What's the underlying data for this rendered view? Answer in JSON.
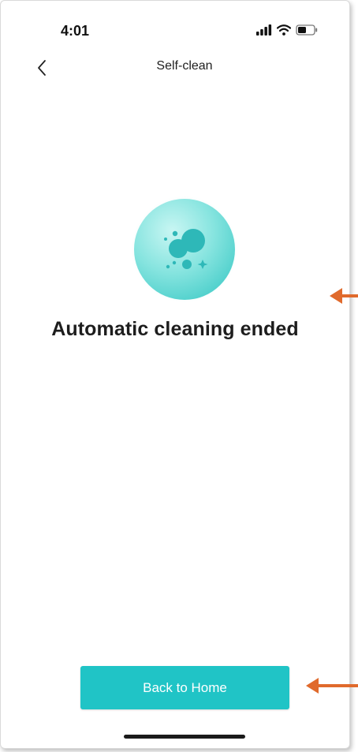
{
  "status_bar": {
    "time": "4:01",
    "icons": [
      "cellular-signal-icon",
      "wifi-icon",
      "battery-icon"
    ]
  },
  "nav": {
    "title": "Self-clean",
    "back_icon": "chevron-left-icon"
  },
  "main": {
    "illustration": "bubbles-icon",
    "message": "Automatic cleaning ended"
  },
  "footer": {
    "button_label": "Back to Home"
  },
  "colors": {
    "accent": "#20c4c6",
    "annotation_arrow": "#e06a2c",
    "bubble": "#7fe0de"
  },
  "annotations": [
    "arrow-pointing-left",
    "arrow-pointing-left"
  ]
}
